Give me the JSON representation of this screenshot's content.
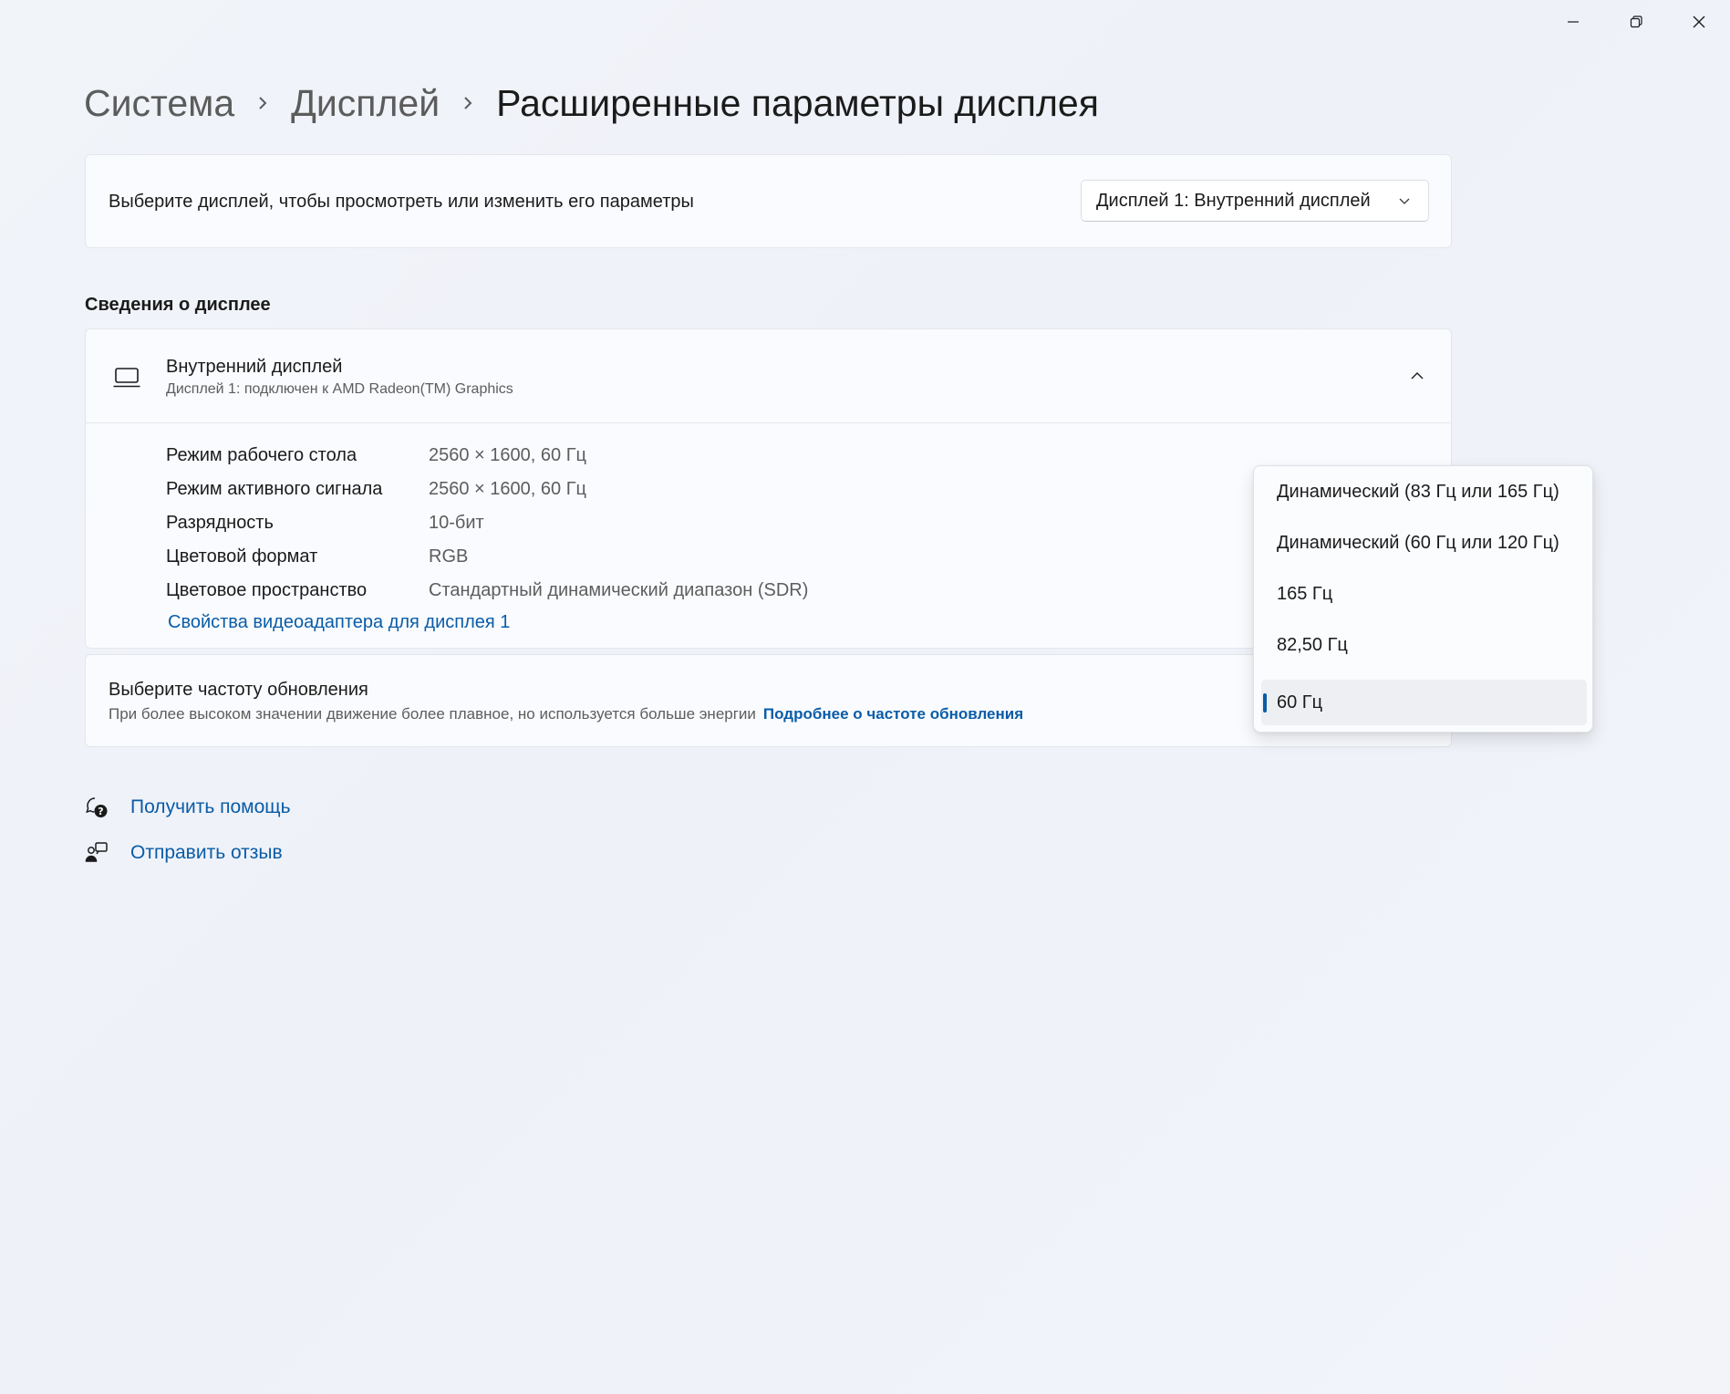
{
  "window": {
    "minimize_icon": "minimize-icon",
    "restore_icon": "restore-icon",
    "close_icon": "close-icon"
  },
  "breadcrumb": {
    "items": [
      "Система",
      "Дисплей"
    ],
    "current": "Расширенные параметры дисплея"
  },
  "display_select": {
    "label": "Выберите дисплей, чтобы просмотреть или изменить его параметры",
    "value": "Дисплей 1: Внутренний дисплей"
  },
  "display_info": {
    "section_title": "Сведения о дисплее",
    "title": "Внутренний дисплей",
    "subtitle": "Дисплей 1: подключен к AMD Radeon(TM) Graphics",
    "rows": [
      {
        "key": "Режим рабочего стола",
        "value": "2560 × 1600, 60 Гц"
      },
      {
        "key": "Режим активного сигнала",
        "value": "2560 × 1600, 60 Гц"
      },
      {
        "key": "Разрядность",
        "value": "10-бит"
      },
      {
        "key": "Цветовой формат",
        "value": "RGB"
      },
      {
        "key": "Цветовое пространство",
        "value": "Стандартный динамический диапазон (SDR)"
      }
    ],
    "adapter_link": "Свойства видеоадаптера для дисплея 1"
  },
  "refresh": {
    "title": "Выберите частоту обновления",
    "description": "При более высоком значении движение более плавное, но используется больше энергии",
    "link": "Подробнее о частоте обновления",
    "options": [
      "Динамический (83 Гц или 165 Гц)",
      "Динамический (60 Гц или 120 Гц)",
      "165 Гц",
      "82,50 Гц",
      "60 Гц"
    ],
    "selected": "60 Гц"
  },
  "help": {
    "get_help": "Получить помощь",
    "feedback": "Отправить отзыв"
  },
  "colors": {
    "accent": "#0a5ca7",
    "background": "#f1f4f9",
    "card": "#fbfcfe"
  }
}
